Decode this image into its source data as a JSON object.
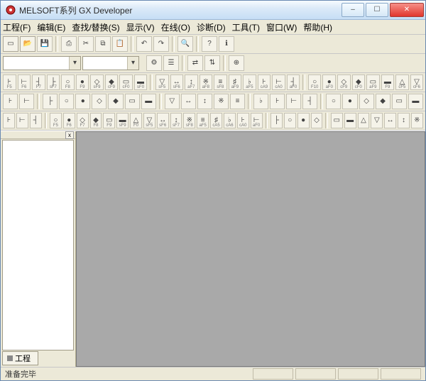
{
  "title": "MELSOFT系列 GX Developer",
  "menu": {
    "file": "工程(F)",
    "edit": "编辑(E)",
    "find": "查找/替换(S)",
    "view": "显示(V)",
    "online": "在线(O)",
    "diag": "诊断(D)",
    "tools": "工具(T)",
    "window": "窗口(W)",
    "help": "帮助(H)"
  },
  "combo1_value": "",
  "combo2_value": "",
  "sidebar": {
    "tab": "工程",
    "close": "x"
  },
  "status_text": "准备完毕",
  "icons": {
    "min": "–",
    "max": "☐",
    "close": "✕",
    "dropdown": "▾",
    "row1": [
      "new",
      "open",
      "save",
      "",
      "print",
      "cut",
      "copy",
      "paste",
      "",
      "undo",
      "redo",
      "",
      "find",
      "",
      "help",
      "help2"
    ],
    "row2b": [
      "cfg",
      "tree",
      "",
      "link1",
      "link2",
      "",
      "zoom"
    ],
    "row3": [
      "l1",
      "l2",
      "l3",
      "l4",
      "l5",
      "l6",
      "l7",
      "l8",
      "l9",
      "l10",
      "",
      "p1",
      "p2",
      "p3",
      "p4",
      "p5",
      "p6",
      "p7",
      "p8",
      "p9",
      "p10",
      "",
      "q1",
      "q2",
      "q3",
      "q4",
      "q5",
      "q6",
      "q7",
      "q8"
    ],
    "row3sub": [
      "F5",
      "F6",
      "F7",
      "sF7",
      "F8",
      "F9",
      "sF9",
      "cF9",
      "cF0",
      "sF0",
      "",
      "sF5",
      "sF6",
      "aF7",
      "aF8",
      "sF8",
      "aF9",
      "aF5",
      "cA9",
      "cA0",
      "aF0",
      "",
      "F10",
      "aF0",
      "cF9",
      "cF0",
      "aF9",
      "F9",
      "cF5",
      "cF6"
    ],
    "row4": [
      "a1",
      "a2",
      "",
      "b1",
      "b2",
      "b3",
      "b4",
      "b5",
      "b6",
      "b7",
      "",
      "c1",
      "c2",
      "c3",
      "c4",
      "c5",
      "",
      "d1",
      "d2",
      "d3",
      "d4",
      "",
      "e1",
      "e2",
      "e3",
      "e4",
      "e5",
      "e6"
    ],
    "row5": [
      "f1",
      "f2",
      "f3",
      "",
      "g1",
      "g2",
      "g3",
      "g4",
      "g5",
      "g6",
      "g7",
      "g8",
      "g9",
      "g10",
      "g11",
      "g12",
      "g13",
      "g14",
      "g15",
      "g16",
      "",
      "h1",
      "h2",
      "h3",
      "h4",
      "",
      "i1",
      "i2",
      "i3",
      "i4",
      "i5",
      "i6",
      "i7"
    ],
    "row5sub": [
      "",
      "",
      "",
      "",
      "F5",
      "F6",
      "F7",
      "F8",
      "F9",
      "sF9",
      "F0",
      "sF5",
      "sF6",
      "sF7",
      "sF8",
      "aF5",
      "cA5",
      "cA6",
      "cA0",
      "aF0",
      "",
      "",
      "",
      "",
      "",
      "",
      "",
      "",
      "",
      "",
      "",
      ""
    ]
  }
}
